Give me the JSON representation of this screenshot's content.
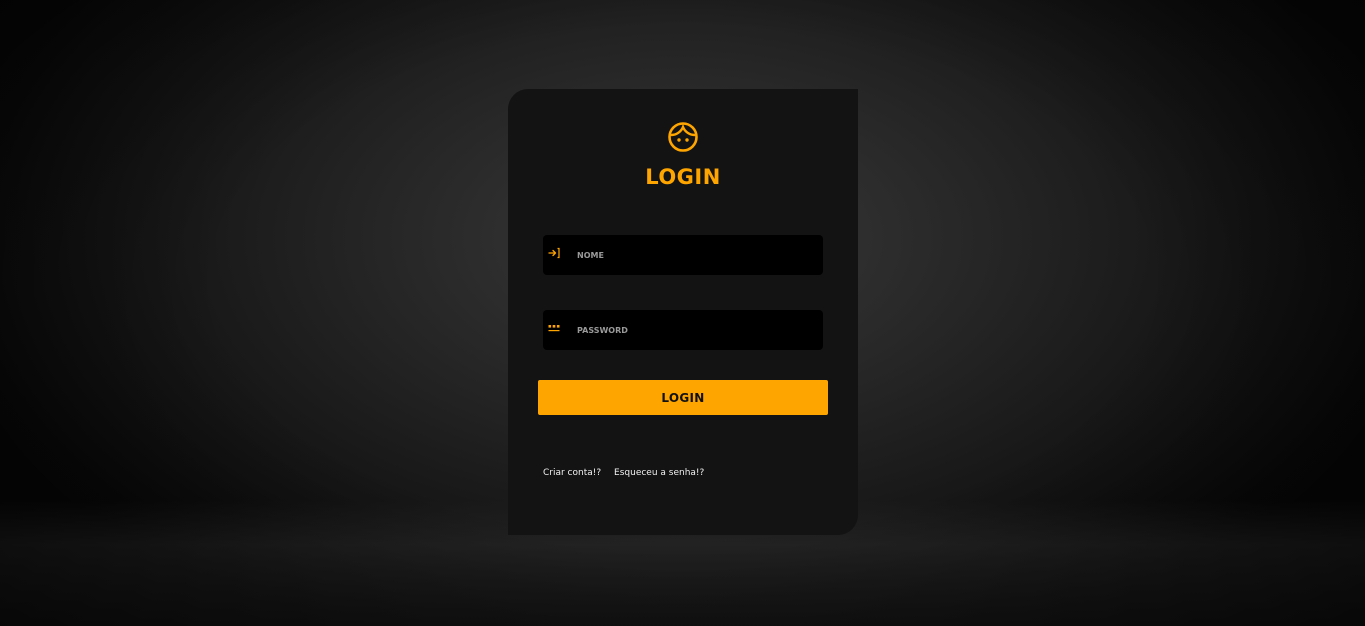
{
  "colors": {
    "accent": "#ffa500",
    "card_background": "#131313",
    "input_background": "#000000",
    "link_text": "#f0f0f0"
  },
  "header": {
    "icon": "face-icon",
    "title": "LOGIN"
  },
  "form": {
    "name_field": {
      "icon": "login-arrow-icon",
      "placeholder": "NOME",
      "value": ""
    },
    "password_field": {
      "icon": "password-dots-icon",
      "placeholder": "PASSWORD",
      "value": ""
    },
    "submit_label": "LOGIN"
  },
  "links": {
    "create_account": "Criar conta!?",
    "forgot_password": "Esqueceu a senha!?"
  }
}
